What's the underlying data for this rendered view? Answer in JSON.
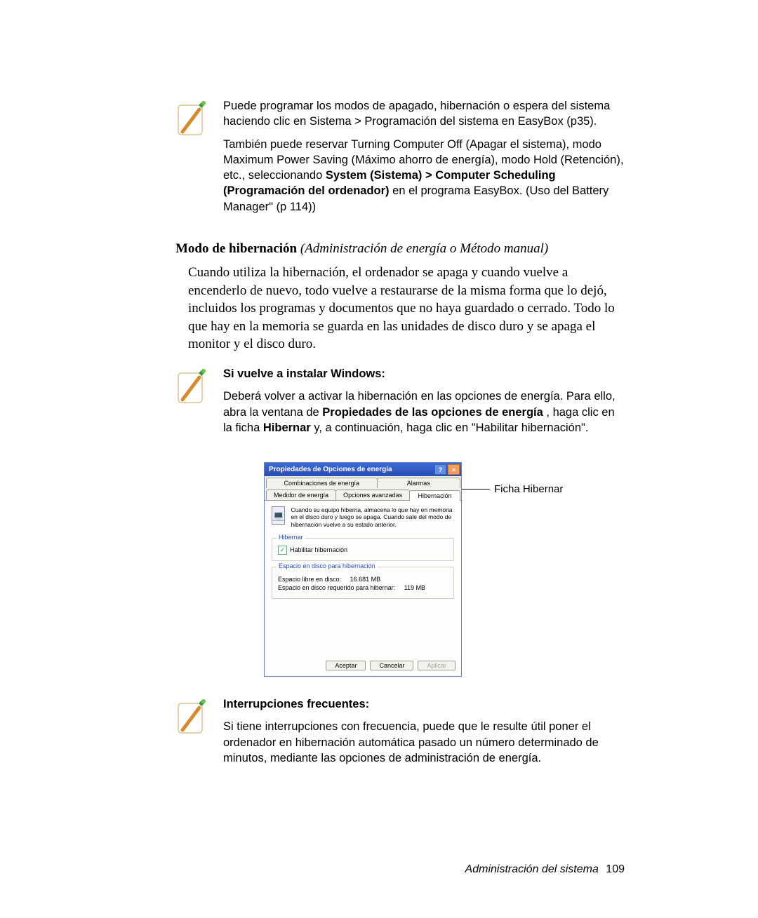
{
  "note1": {
    "para1_pre": "Puede programar los modos de apagado, hibernación o espera del sistema haciendo clic en Sistema > Programación del sistema en EasyBox (p35).",
    "para2_pre": "También puede reservar Turning Computer Off (Apagar el sistema), modo Maximum Power Saving (Máximo ahorro de energía), modo Hold (Retención), etc., seleccionando ",
    "para2_bold": "System (Sistema) > Computer Scheduling (Programación del ordenador)",
    "para2_post": " en el programa EasyBox. (Uso del Battery Manager\" (p 114))"
  },
  "section": {
    "title_bold": "Modo de hibernación",
    "title_ital": " (Administración de energía o Método manual)",
    "body": "Cuando utiliza la hibernación, el ordenador se apaga y cuando vuelve a encenderlo de nuevo, todo vuelve a restaurarse de la misma forma que lo dejó, incluidos los programas y documentos que no haya guardado o cerrado. Todo lo que hay en la memoria se guarda en las unidades de disco duro y se apaga el monitor y el disco duro."
  },
  "note2": {
    "title": "Si vuelve a instalar Windows:",
    "p_pre": "Deberá volver a activar la hibernación en las opciones de energía. Para ello, abra la ventana de ",
    "p_bold1": "Propiedades de las opciones de energía",
    "p_mid": " , haga clic en la ficha ",
    "p_bold2": "Hibernar",
    "p_post": " y, a continuación, haga clic en \"Habilitar hibernación\"."
  },
  "dialog": {
    "title": "Propiedades de Opciones de energía",
    "tabs_row1": {
      "a": "Combinaciones de energía",
      "b": "Alarmas"
    },
    "tabs_row2": {
      "a": "Medidor de energía",
      "b": "Opciones avanzadas",
      "c": "Hibernación"
    },
    "info": "Cuando su equipo hiberna, almacena lo que hay en memoria en el disco duro y luego se apaga. Cuando sale del modo de hibernación vuelve a su estado anterior.",
    "group1_legend": "Hibernar",
    "chk_label": "Habilitar hibernación",
    "group2_legend": "Espacio en disco para hibernación",
    "kv1_label": "Espacio libre en disco:",
    "kv1_value": "16.681 MB",
    "kv2_label": "Espacio en disco requerido para hibernar:",
    "kv2_value": "119 MB",
    "btn_ok": "Aceptar",
    "btn_cancel": "Cancelar",
    "btn_apply": "Aplicar"
  },
  "callout": "Ficha Hibernar",
  "note3": {
    "title": "Interrupciones frecuentes:",
    "body": "Si tiene interrupciones con frecuencia, puede que le resulte útil poner el ordenador en hibernación automática pasado un número determinado de minutos, mediante las opciones de administración de energía."
  },
  "footer": {
    "section": "Administración del sistema",
    "page": "109"
  }
}
